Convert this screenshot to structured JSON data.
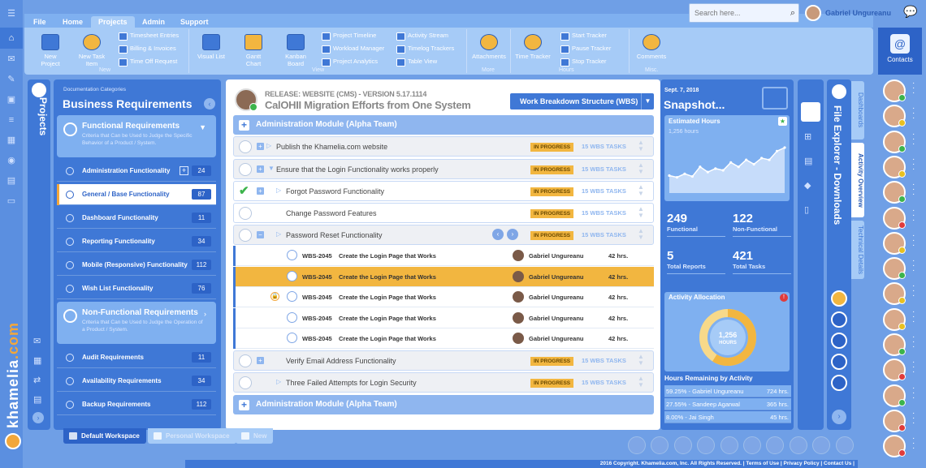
{
  "menu": {
    "tabs": [
      "File",
      "Home",
      "Projects",
      "Admin",
      "Support"
    ],
    "active": "Projects"
  },
  "search": {
    "placeholder": "Search here..."
  },
  "user": {
    "name": "Gabriel Ungureanu"
  },
  "ribbon": {
    "new_project": "New Project",
    "new_task": "New Task Item",
    "timesheet": "Timesheet Entries",
    "billing": "Billing & Invoices",
    "timeoff": "Time Off Request",
    "visual_list": "Visual List",
    "gantt": "Gantt Chart",
    "kanban": "Kanban Board",
    "timeline": "Project Timeline",
    "workload": "Workload Manager",
    "analytics": "Project Analytics",
    "activity": "Activity Stream",
    "timelog": "Timelog Trackers",
    "tableview": "Table View",
    "attachments": "Attachments",
    "timetracker": "Time Tracker",
    "start": "Start Tracker",
    "pause": "Pause Tracker",
    "stop": "Stop Tracker",
    "comments": "Comments",
    "groups": [
      "New",
      "View",
      "More",
      "Hours",
      "Misc."
    ]
  },
  "contacts": {
    "label": "Contacts",
    "statuses": [
      "#3cb44b",
      "#e8c020",
      "#3cb44b",
      "#e8c020",
      "#3cb44b",
      "#e03b3b",
      "#e8c020",
      "#3cb44b",
      "#e8c020",
      "#e8c020",
      "#3cb44b",
      "#e03b3b",
      "#3cb44b",
      "#e03b3b",
      "#e03b3b"
    ]
  },
  "projects_label": "Projects",
  "brand": {
    "a": "khamelia",
    "b": ".com"
  },
  "categories": {
    "label": "Documentation Categories",
    "title": "Business Requirements",
    "functional": {
      "title": "Functional Requirements",
      "desc": "Criteria that Can be Used to Judge the Specific Behavior of a Product / System."
    },
    "functional_items": [
      {
        "label": "Administration Functionality",
        "count": "24"
      },
      {
        "label": "General / Base Functionality",
        "count": "87"
      },
      {
        "label": "Dashboard Functionality",
        "count": "11"
      },
      {
        "label": "Reporting Functionality",
        "count": "34"
      },
      {
        "label": "Mobile (Responsive) Functionality",
        "count": "112"
      },
      {
        "label": "Wish List Functionality",
        "count": "76"
      }
    ],
    "nonfunctional": {
      "title": "Non-Functional Requirements",
      "desc": "Criteria that Can be Used to Judge the Operation of a Product / System."
    },
    "nonfunctional_items": [
      {
        "label": "Audit Requirements",
        "count": "11"
      },
      {
        "label": "Availability Requirements",
        "count": "34"
      },
      {
        "label": "Backup Requirements",
        "count": "112"
      }
    ]
  },
  "release": {
    "line1": "RELEASE: WEBSITE (CMS) - VERSION 5.17.1114",
    "line2": "CalOHII Migration Efforts from One System",
    "wbs": "Work Breakdown Structure (WBS)"
  },
  "module": {
    "title": "Administration Module (Alpha Team)"
  },
  "tasks": [
    {
      "title": "Publish the Khamelia.com website",
      "status": "IN PROGRESS",
      "wbs": "15 WBS TASKS"
    },
    {
      "title": "Ensure that the Login Functionality works properly",
      "status": "IN PROGRESS",
      "wbs": "15 WBS TASKS"
    },
    {
      "title": "Forgot Password Functionality",
      "status": "IN PROGRESS",
      "wbs": "15 WBS TASKS"
    },
    {
      "title": "Change Password Features",
      "status": "IN PROGRESS",
      "wbs": "15 WBS TASKS"
    },
    {
      "title": "Password Reset Functionality",
      "status": "IN PROGRESS",
      "wbs": "15 WBS TASKS"
    },
    {
      "title": "Verify Email Address Functionality",
      "status": "IN PROGRESS",
      "wbs": "15 WBS TASKS"
    },
    {
      "title": "Three Failed Attempts for Login Security",
      "status": "IN PROGRESS",
      "wbs": "15 WBS TASKS"
    }
  ],
  "subtasks": [
    {
      "id": "WBS-2045",
      "title": "Create the Login Page that Works",
      "user": "Gabriel Ungureanu",
      "hours": "42 hrs."
    },
    {
      "id": "WBS-2045",
      "title": "Create the Login Page that Works",
      "user": "Gabriel Ungureanu",
      "hours": "42 hrs."
    },
    {
      "id": "WBS-2045",
      "title": "Create the Login Page that Works",
      "user": "Gabriel Ungureanu",
      "hours": "42 hrs."
    },
    {
      "id": "WBS-2045",
      "title": "Create the Login Page that Works",
      "user": "Gabriel Ungureanu",
      "hours": "42 hrs."
    },
    {
      "id": "WBS-2045",
      "title": "Create the Login Page that Works",
      "user": "Gabriel Ungureanu",
      "hours": "42 hrs."
    }
  ],
  "snapshot": {
    "date": "Sept. 7, 2018",
    "title": "Snapshot...",
    "est_title": "Estimated Hours",
    "est_value": "1,256 hours",
    "est_series": [
      20,
      18,
      22,
      19,
      30,
      24,
      28,
      26,
      35,
      30,
      38,
      33,
      40,
      38,
      48,
      52
    ],
    "kpis": [
      {
        "value": "249",
        "label": "Functional"
      },
      {
        "value": "122",
        "label": "Non-Functional"
      },
      {
        "value": "5",
        "label": "Total Reports"
      },
      {
        "value": "421",
        "label": "Total Tasks"
      }
    ],
    "act_title": "Activity Allocation",
    "donut_value": "1,256",
    "donut_unit": "HOURS",
    "donut_fraction": 0.59,
    "hr_title": "Hours Remaining by Activity",
    "hr_rows": [
      {
        "name": "59.25% - Gabriel Ungureanu",
        "hours": "724 hrs."
      },
      {
        "name": "27.55% - Sandeep Agarwal",
        "hours": "365 hrs."
      },
      {
        "name": "8.00% - Jai Singh",
        "hours": "45 hrs."
      }
    ]
  },
  "fileexplorer": {
    "title": "File Explorer - Downloads",
    "tabs": [
      "Dashboards",
      "Activity Overview",
      "Technical Details"
    ]
  },
  "workspaces": [
    "Default Workspace",
    "Personal Workspace",
    "New"
  ],
  "footer": "2016 Copyright. Khamelia.com, Inc. All Rights Reserved. | Terms of Use | Privacy Policy | Contact Us |"
}
